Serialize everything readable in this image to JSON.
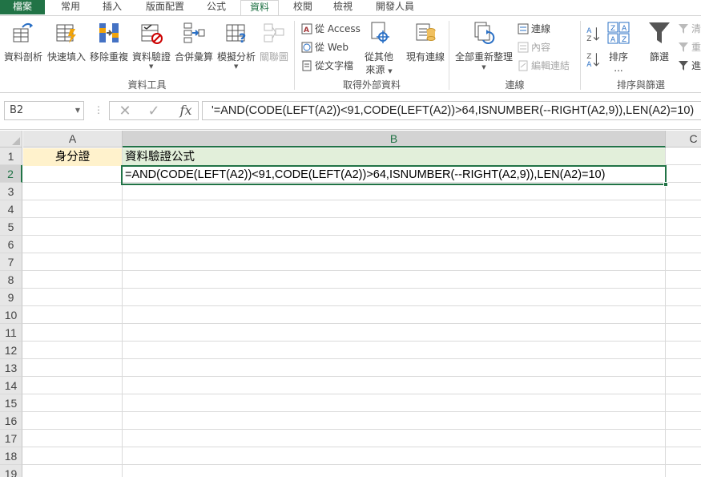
{
  "ribbon_tabs": [
    {
      "label": "檔案"
    },
    {
      "label": "常用"
    },
    {
      "label": "插入"
    },
    {
      "label": "版面配置"
    },
    {
      "label": "公式"
    },
    {
      "label": "資料"
    },
    {
      "label": "校閱"
    },
    {
      "label": "檢視"
    },
    {
      "label": "開發人員"
    }
  ],
  "active_tab": "資料",
  "data_tools": {
    "buttons": [
      {
        "label": "資料剖析",
        "icon": "text-to-columns-icon"
      },
      {
        "label": "快速填入",
        "icon": "flash-fill-icon"
      },
      {
        "label": "移除重複",
        "icon": "remove-duplicates-icon"
      },
      {
        "label": "資料驗證",
        "icon": "data-validation-icon"
      },
      {
        "label": "合併彙算",
        "icon": "consolidate-icon"
      },
      {
        "label": "模擬分析",
        "icon": "what-if-analysis-icon"
      },
      {
        "label": "關聯圖",
        "icon": "relationships-icon"
      }
    ],
    "group_label": "資料工具"
  },
  "external_data": {
    "from_access": "從 Access",
    "from_web": "從 Web",
    "from_text": "從文字檔",
    "other_sources_line1": "從其他",
    "other_sources_line2": "來源",
    "existing_connections": "現有連線",
    "group_label": "取得外部資料"
  },
  "connections": {
    "refresh_all": "全部重新整理",
    "connections": "連線",
    "properties": "內容",
    "edit_links": "編輯連結",
    "group_label": "連線"
  },
  "sort_filter": {
    "sort": "排序",
    "sort_more": "...",
    "filter": "篩選",
    "clear": "清",
    "reapply": "重",
    "advanced": "進",
    "group_label": "排序與篩選"
  },
  "formula_bar": {
    "name_box": "B2",
    "formula": "'=AND(CODE(LEFT(A2))<91,CODE(LEFT(A2))>64,ISNUMBER(--RIGHT(A2,9)),LEN(A2)=10)",
    "fx": "fx"
  },
  "grid": {
    "columns": [
      "A",
      "B",
      "C"
    ],
    "rows": [
      "1",
      "2",
      "3",
      "4",
      "5",
      "6",
      "7",
      "8",
      "9",
      "10",
      "11",
      "12",
      "13",
      "14",
      "15",
      "16",
      "17",
      "18",
      "19"
    ],
    "A1": "身分證",
    "B1": "資料驗證公式",
    "B2": "=AND(CODE(LEFT(A2))<91,CODE(LEFT(A2))>64,ISNUMBER(--RIGHT(A2,9)),LEN(A2)=10)",
    "selected_cell": "B2"
  },
  "colors": {
    "accent": "#217346",
    "a1_fill": "#fff2cc",
    "b1_fill": "#e2efda"
  }
}
